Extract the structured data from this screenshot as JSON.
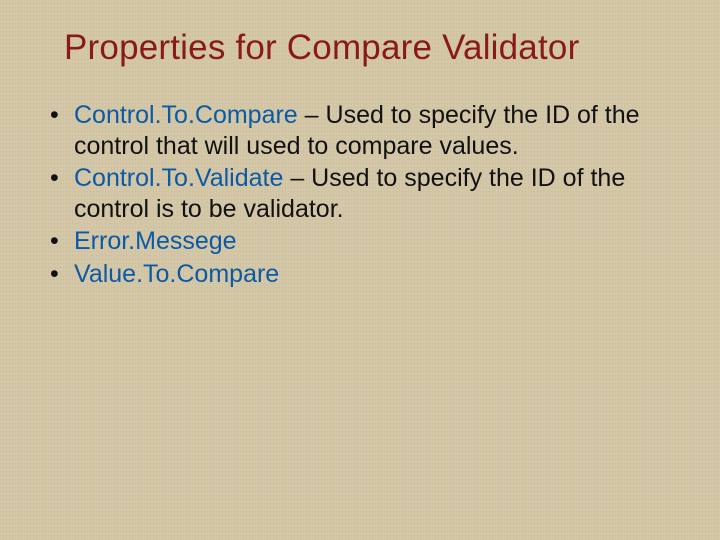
{
  "title": "Properties for Compare Validator",
  "bullets": [
    {
      "term": "Control.To.Compare",
      "desc": " – Used to specify the ID of the control that will used to compare values."
    },
    {
      "term": "Control.To.Validate",
      "desc": " – Used to specify the ID of the control is to be validator."
    },
    {
      "term": "Error.Messege",
      "desc": ""
    },
    {
      "term": "Value.To.Compare",
      "desc": ""
    }
  ]
}
